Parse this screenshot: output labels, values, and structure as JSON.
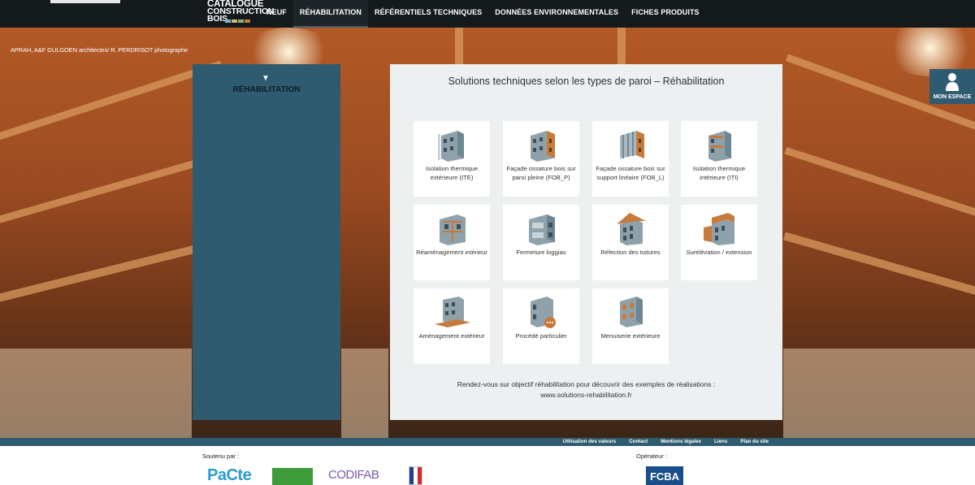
{
  "header": {
    "logo_lines": [
      "CATALOGUE",
      "CONSTRUCTION",
      "BOIS"
    ],
    "nav": [
      {
        "label": "NEUF",
        "active": false
      },
      {
        "label": "RÉHABILITATION",
        "active": true
      },
      {
        "label": "RÉFÉRENTIELS TECHNIQUES",
        "active": false
      },
      {
        "label": "DONNÉES ENVIRONNEMENTALES",
        "active": false
      },
      {
        "label": "FICHES PRODUITS",
        "active": false
      }
    ]
  },
  "hero": {
    "photo_credit": "APRAH, A&F GULGOEN architectes/ R. PERDRISOT photographe"
  },
  "sidebar": {
    "title": "RÉHABILITATION"
  },
  "main": {
    "title": "Solutions techniques selon les types de paroi – Réhabilitation",
    "cards": [
      {
        "label": "Isolation thermique extérieure (ITE)",
        "icon": "ite-wall-icon"
      },
      {
        "label": "Façade ossature bois sur paroi pleine (FOB_P)",
        "icon": "fob-p-wall-icon"
      },
      {
        "label": "Façade ossature bois sur support linéaire (FOB_L)",
        "icon": "fob-l-wall-icon"
      },
      {
        "label": "Isolation thermique intérieure (ITI)",
        "icon": "iti-wall-icon"
      },
      {
        "label": "Réaménagement intérieur",
        "icon": "interior-rework-icon"
      },
      {
        "label": "Fermeture loggias",
        "icon": "loggia-icon"
      },
      {
        "label": "Réfection des toitures",
        "icon": "roof-icon"
      },
      {
        "label": "Surélévation / extension",
        "icon": "extension-icon"
      },
      {
        "label": "Aménagement extérieur",
        "icon": "exterior-layout-icon"
      },
      {
        "label": "Procédé particulier",
        "icon": "special-process-icon"
      },
      {
        "label": "Menuiserie extérieure",
        "icon": "joinery-icon"
      }
    ],
    "footer_text_line1": "Rendez-vous sur objectif réhabilitation pour découvrir des exemples de réalisations :",
    "footer_text_line2": "www.solutions-rehabilitation.fr"
  },
  "account": {
    "label": "MON ESPACE",
    "icon": "user-icon"
  },
  "footer": {
    "links": [
      "Utilisation des valeurs",
      "Contact",
      "Mentions légales",
      "Liens",
      "Plan du site"
    ],
    "supported_by": "Soutenu par :",
    "operator": "Opérateur :",
    "sponsors": [
      "PaCte",
      "CODIFAB"
    ],
    "operator_logo": "FCBA"
  },
  "colors": {
    "topbar": "#14191c",
    "accent": "#2e5b70",
    "panel": "#edf0f1",
    "wood": "#c77a3c"
  }
}
